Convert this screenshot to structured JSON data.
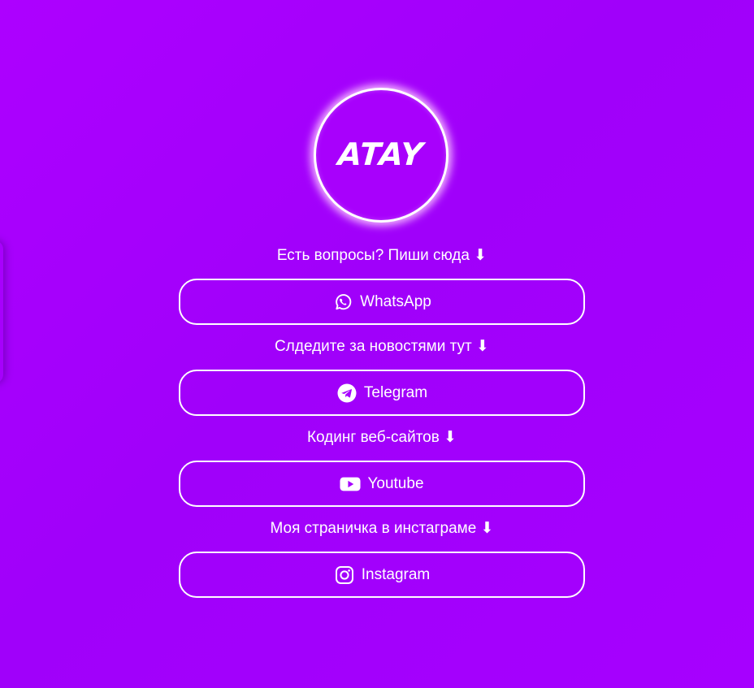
{
  "logo": {
    "text": "ATAY"
  },
  "sections": [
    {
      "caption": "Есть вопросы? Пиши сюда ⬇",
      "button_label": "WhatsApp",
      "icon": "whatsapp-icon"
    },
    {
      "caption": "Слдедите за новостями тут ⬇",
      "button_label": "Telegram",
      "icon": "telegram-icon"
    },
    {
      "caption": "Кодинг веб-сайтов ⬇",
      "button_label": "Youtube",
      "icon": "youtube-icon"
    },
    {
      "caption": "Моя страничка в инстаграме ⬇",
      "button_label": "Instagram",
      "icon": "instagram-icon"
    }
  ],
  "colors": {
    "background": "#a600ff",
    "text": "#ffffff",
    "border": "#ffffff"
  }
}
